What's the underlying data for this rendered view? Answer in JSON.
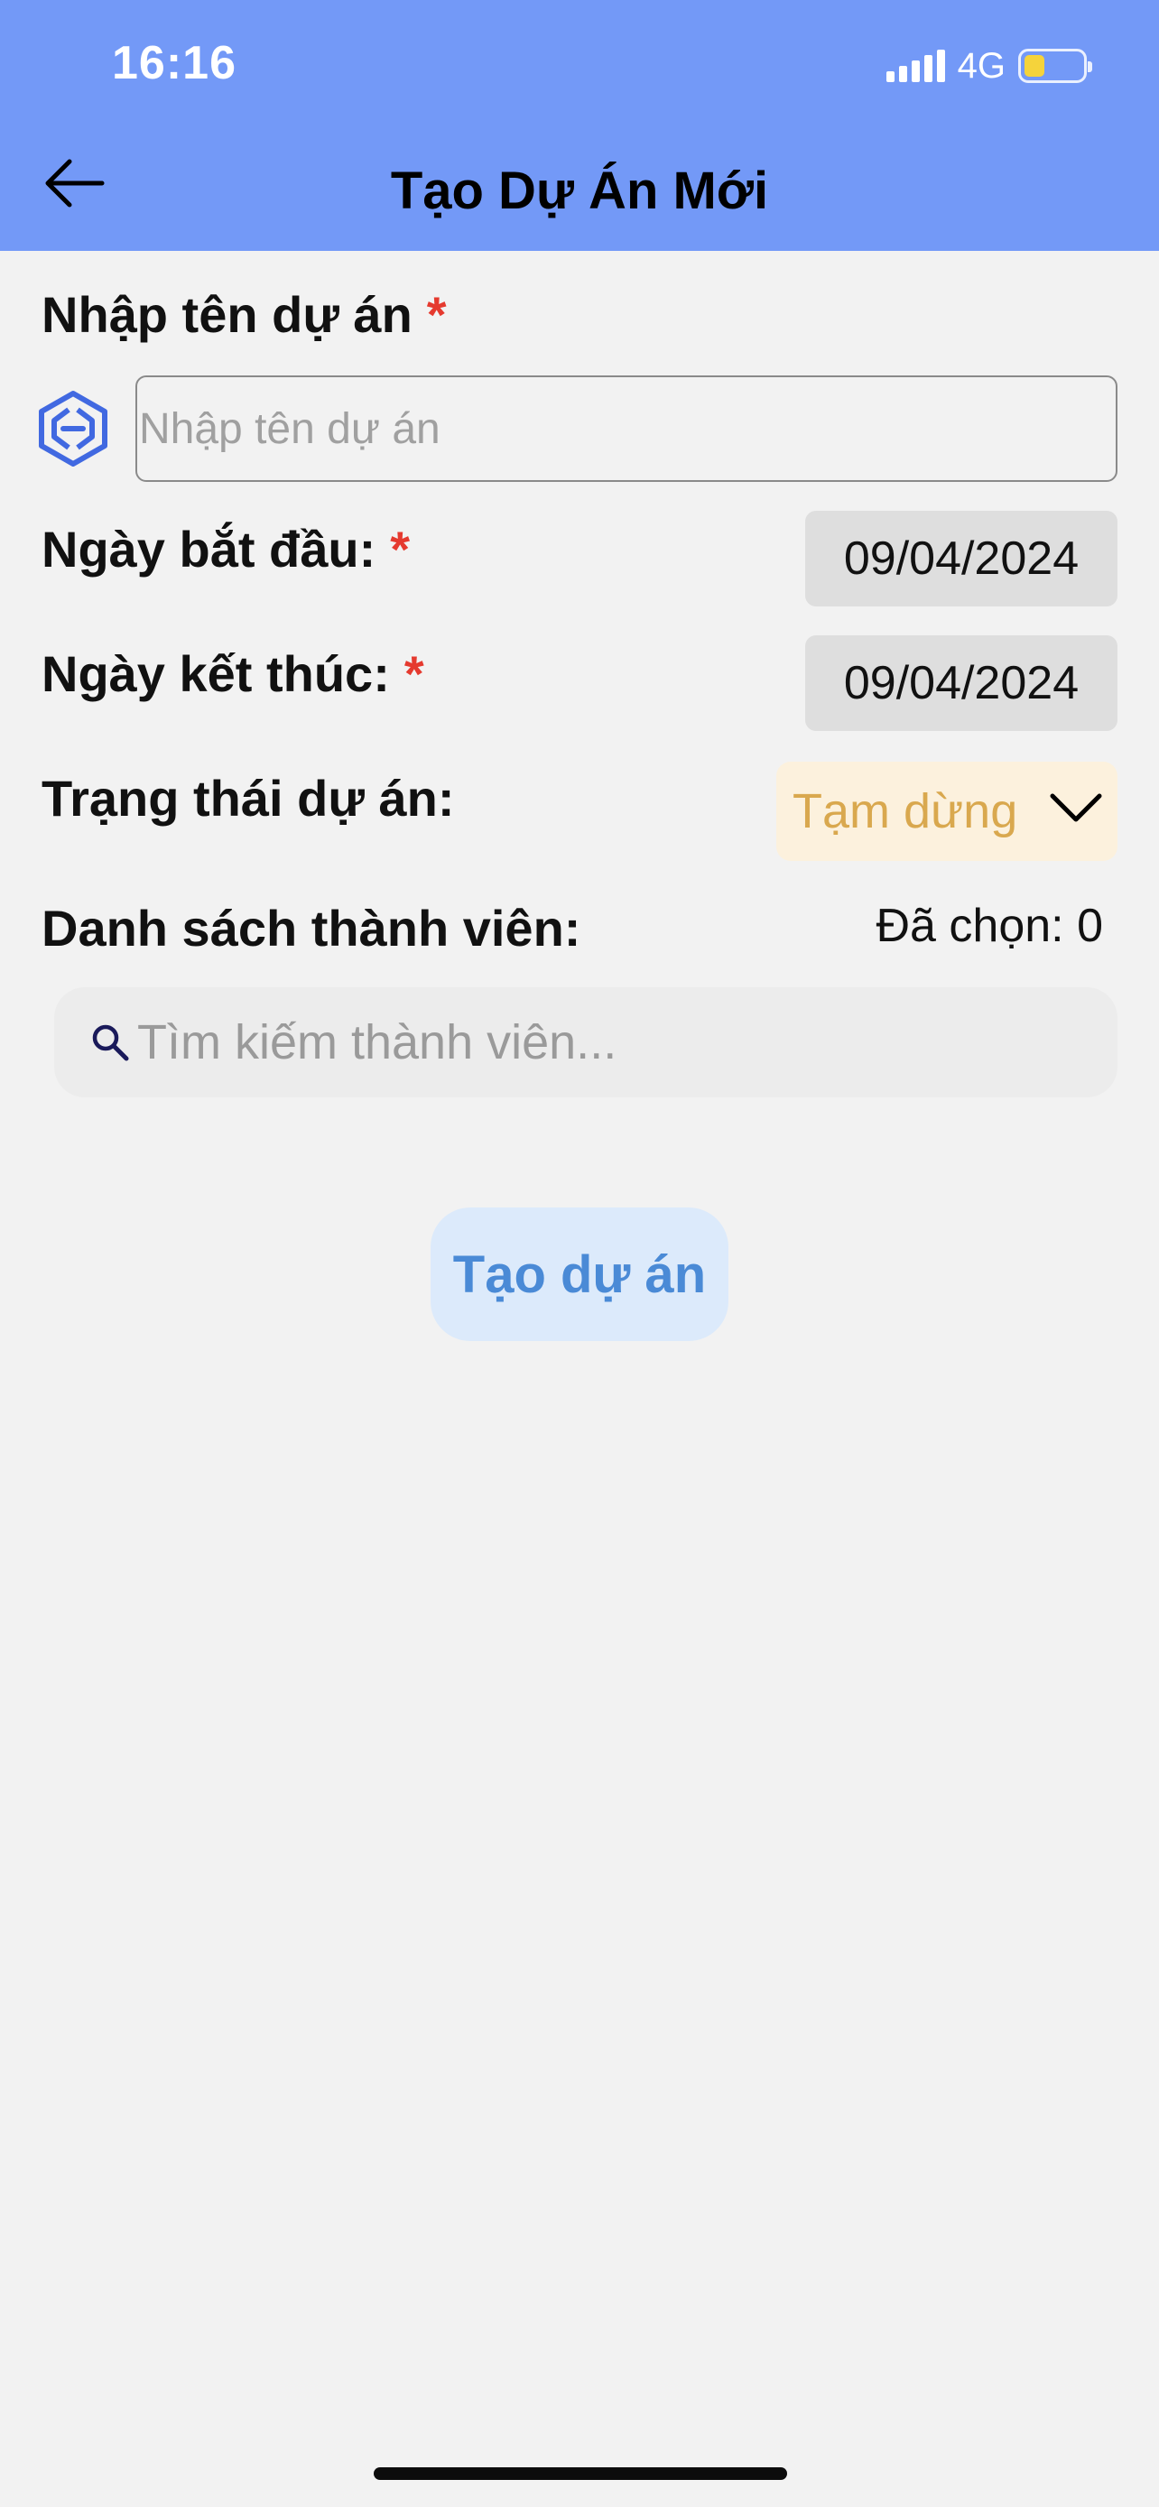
{
  "status_bar": {
    "time": "16:16",
    "network": "4G"
  },
  "header": {
    "title": "Tạo Dự Án Mới",
    "back_icon": "arrow-left-icon"
  },
  "form": {
    "project_name": {
      "label": "Nhập tên dự án",
      "required_mark": "*",
      "placeholder": "Nhập tên dự án",
      "value": ""
    },
    "start_date": {
      "label": "Ngày bắt đầu:",
      "required_mark": "*",
      "value": "09/04/2024"
    },
    "end_date": {
      "label": "Ngày kết thúc:",
      "required_mark": "*",
      "value": "09/04/2024"
    },
    "status": {
      "label": "Trạng thái dự án:",
      "value": "Tạm dừng",
      "color": "#d9a84e",
      "background": "#fcf1dd"
    },
    "members": {
      "label": "Danh sách thành viên:",
      "selected_text": "Đã chọn: 0",
      "search_placeholder": "Tìm kiếm thành viên..."
    },
    "submit_label": "Tạo dự án"
  },
  "colors": {
    "header": "#7399f7",
    "required": "#e53a2f",
    "button_text": "#4a8ad6",
    "button_bg": "#dceafb",
    "icon": "#4169e1"
  }
}
